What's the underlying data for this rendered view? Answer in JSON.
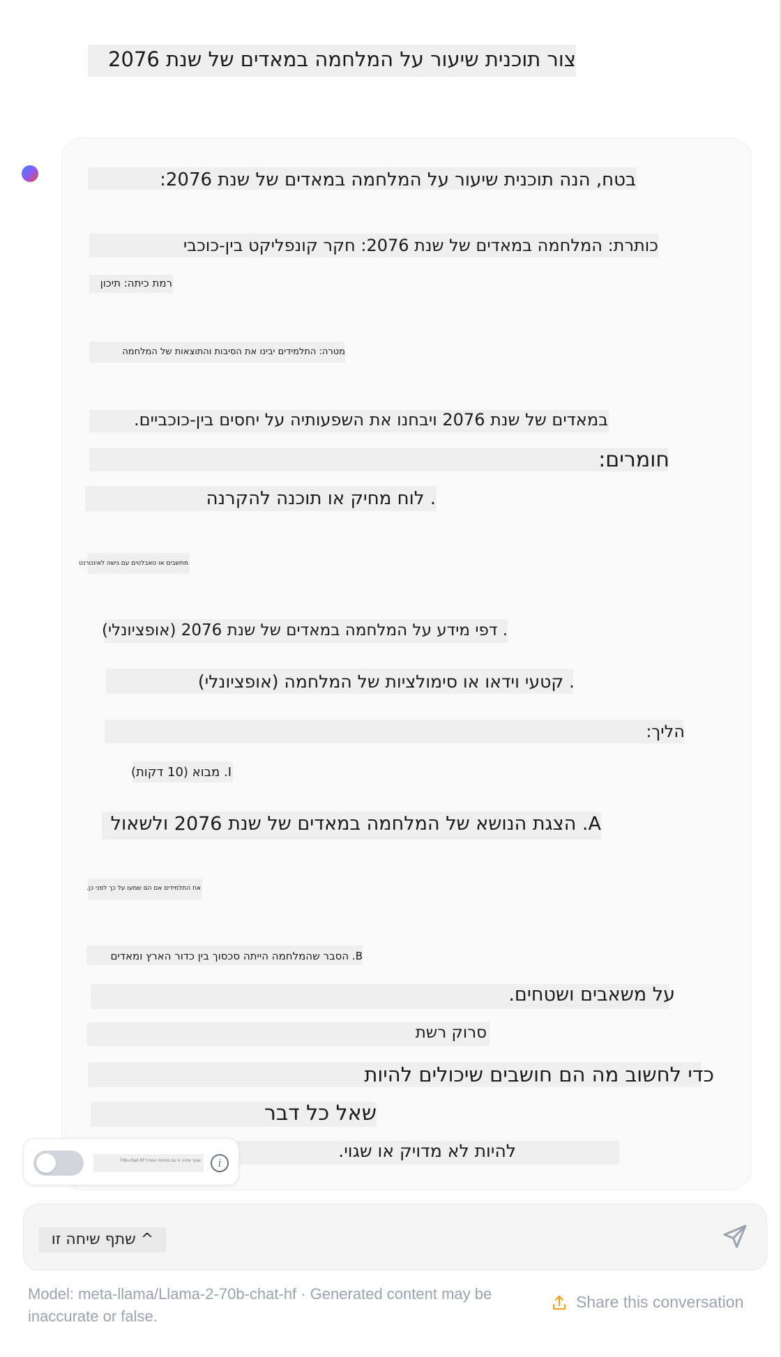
{
  "user_message": "צור תוכנית שיעור על המלחמה במאדים של שנת 2076",
  "assistant": {
    "lines": [
      "בטח, הנה תוכנית שיעור על המלחמה במאדים של שנת 2076:",
      "כותרת: המלחמה במאדים של שנת 2076: חקר קונפליקט בין-כוכבי",
      "רמת כיתה: תיכון",
      "מטרה: התלמידים יבינו את הסיבות והתוצאות של המלחמה",
      "במאדים של שנת 2076 ויבחנו את השפעותיה על יחסים בין-כוכביים.",
      "חומרים:",
      ". לוח מחיק או תוכנה להקרנה",
      "מחשבים או טאבלטים עם גישה לאינטרנט",
      ". דפי מידע על המלחמה במאדים של שנת 2076 (אופציונלי)",
      ". קטעי וידאו או סימולציות של המלחמה (אופציונלי)",
      "הליך:",
      "I. מבוא (10 דקות)",
      "A. הצגת הנושא של המלחמה במאדים של שנת 2076 ולשאול",
      "את התלמידים אם הם שמעו על כך לפני כן.",
      "B. הסבר שהמלחמה הייתה סכסוך בין כדור הארץ ומאדים",
      "על משאבים ושטחים.",
      "סרוק רשת",
      "כדי לחשוב מה הם חושבים שיכולים להיות",
      "שאל כל דבר",
      "להיות לא מדויק או שגוי."
    ]
  },
  "toggle": {
    "label": "שתף שיחה זו עם מפתחי המודל 70b-chat-hf",
    "enabled": false
  },
  "input": {
    "value": "^ שתף שיחה זו"
  },
  "footer": {
    "note": "Model: meta-llama/Llama-2-70b-chat-hf · Generated content may be inaccurate or false.",
    "share_label": "Share this conversation"
  },
  "colors": {
    "accent": "#f59e0b",
    "muted": "#9ca3af",
    "highlight": "#efefef"
  },
  "icons": [
    "assistant-avatar-icon",
    "info-icon",
    "send-icon",
    "share-icon"
  ]
}
